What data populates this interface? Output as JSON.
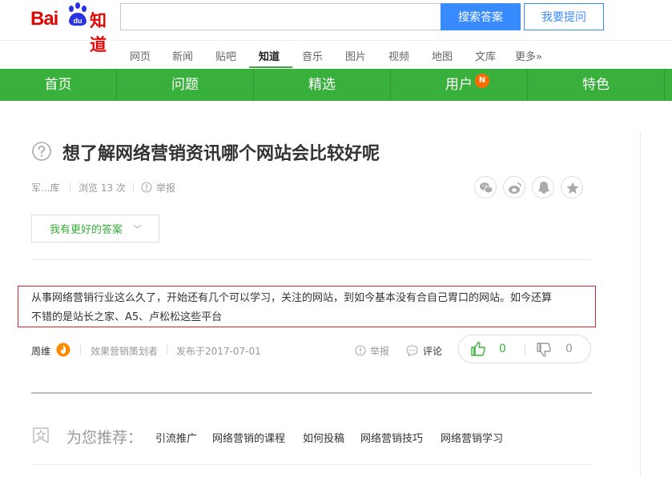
{
  "header": {
    "logo_bai": "Bai",
    "logo_du": "du",
    "logo_zhidao": "知道",
    "search_placeholder": "",
    "search_button": "搜索答案",
    "ask_button": "我要提问"
  },
  "channels": [
    {
      "label": "网页",
      "active": false
    },
    {
      "label": "新闻",
      "active": false
    },
    {
      "label": "贴吧",
      "active": false
    },
    {
      "label": "知道",
      "active": true
    },
    {
      "label": "音乐",
      "active": false
    },
    {
      "label": "图片",
      "active": false
    },
    {
      "label": "视频",
      "active": false
    },
    {
      "label": "地图",
      "active": false
    },
    {
      "label": "文库",
      "active": false
    },
    {
      "label": "更多»",
      "active": false
    }
  ],
  "main_nav": {
    "items": [
      "首页",
      "问题",
      "精选",
      "用户",
      "特色"
    ],
    "user_badge": "N"
  },
  "question": {
    "title": "想了解网络营销资讯哪个网站会比较好呢",
    "asker": "军...库",
    "views": "浏览 13 次",
    "report": "举报"
  },
  "share_icons": [
    "wechat-icon",
    "weibo-icon",
    "qq-icon",
    "star-icon"
  ],
  "better_answer_button": "我有更好的答案",
  "answer": {
    "text_line1": "从事网络营销行业这么久了，开始还有几个可以学习，关注的网站，到如今基本没有合自己胃口的网站。如今还算",
    "text_line2": "不错的是站长之家、A5、卢松松这些平台",
    "author": "周维",
    "author_title": "效果营销策划者",
    "published": "发布于2017-07-01",
    "report": "举报",
    "comment": "评论",
    "likes": "0",
    "dislikes": "0"
  },
  "recommend": {
    "title": "为您推荐：",
    "links": [
      "引流推广",
      "网络营销的课程",
      "如何投稿",
      "网络营销技巧",
      "网络营销学习"
    ]
  },
  "colors": {
    "brand_red": "#e10602",
    "brand_blue": "#2932e1",
    "nav_green": "#38b03b",
    "search_blue": "#388bff",
    "highlight_red": "#d0272d",
    "badge_orange": "#ff6a00"
  }
}
